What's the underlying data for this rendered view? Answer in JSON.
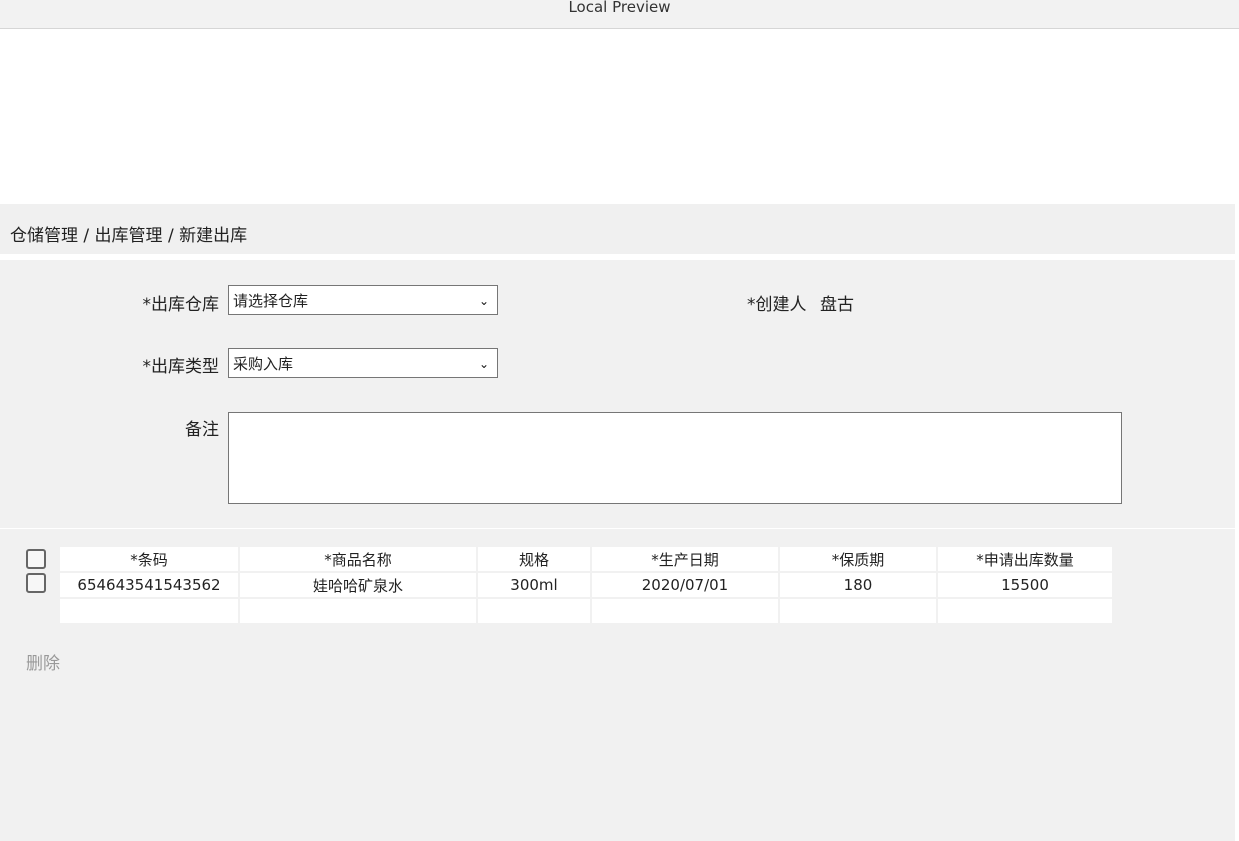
{
  "window": {
    "title": "Local Preview"
  },
  "breadcrumb": "仓储管理 / 出库管理 / 新建出库",
  "form": {
    "warehouse_label": "*出库仓库",
    "warehouse_value": "请选择仓库",
    "creator_label": "*创建人",
    "creator_value": "盘古",
    "type_label": "*出库类型",
    "type_value": "采购入库",
    "remark_label": "备注",
    "remark_value": ""
  },
  "table": {
    "headers": [
      "*条码",
      "*商品名称",
      "规格",
      "*生产日期",
      "*保质期",
      "*申请出库数量"
    ],
    "rows": [
      [
        "654643541543562",
        "娃哈哈矿泉水",
        "300ml",
        "2020/07/01",
        "180",
        "15500"
      ],
      [
        "",
        "",
        "",
        "",
        "",
        ""
      ]
    ]
  },
  "actions": {
    "delete_label": "删除"
  },
  "icons": {
    "dropdown": "chevron-down-icon",
    "checkbox": "checkbox-icon"
  },
  "colors": {
    "panel_bg": "#f1f1f1",
    "border": "#767676",
    "muted_text": "#999999"
  }
}
